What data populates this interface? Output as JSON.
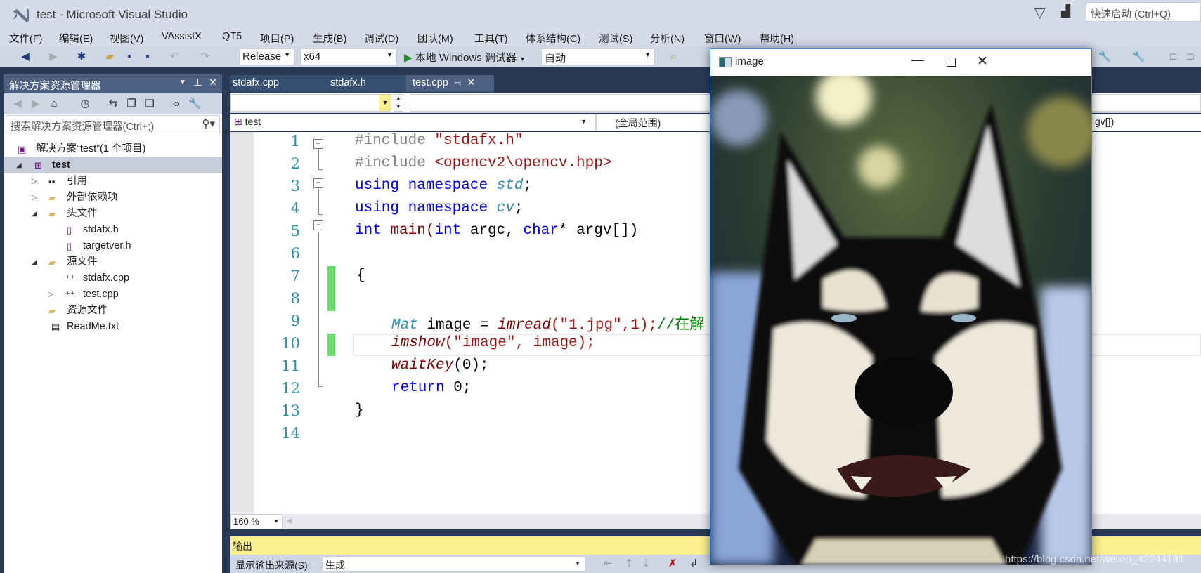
{
  "window": {
    "title": "test - Microsoft Visual Studio",
    "quick_launch_placeholder": "快速启动 (Ctrl+Q)"
  },
  "menu": [
    "文件(F)",
    "编辑(E)",
    "视图(V)",
    "VAssistX",
    "QT5",
    "项目(P)",
    "生成(B)",
    "调试(D)",
    "团队(M)",
    "工具(T)",
    "体系结构(C)",
    "测试(S)",
    "分析(N)",
    "窗口(W)",
    "帮助(H)"
  ],
  "toolbar": {
    "config": "Release",
    "platform": "x64",
    "run_label": "本地 Windows 调试器",
    "mode": "自动"
  },
  "solution_explorer": {
    "title": "解决方案资源管理器",
    "search_placeholder": "搜索解决方案资源管理器(Ctrl+;)",
    "items": [
      {
        "label": "解决方案“test”(1 个项目)"
      },
      {
        "label": "test"
      },
      {
        "label": "引用"
      },
      {
        "label": "外部依赖项"
      },
      {
        "label": "头文件"
      },
      {
        "label": "stdafx.h"
      },
      {
        "label": "targetver.h"
      },
      {
        "label": "源文件"
      },
      {
        "label": "stdafx.cpp"
      },
      {
        "label": "test.cpp"
      },
      {
        "label": "资源文件"
      },
      {
        "label": "ReadMe.txt"
      }
    ]
  },
  "tabs": [
    {
      "label": "stdafx.cpp"
    },
    {
      "label": "stdafx.h"
    },
    {
      "label": "test.cpp",
      "active": true
    }
  ],
  "nav": {
    "project": "test",
    "scope": "(全局范围)",
    "member": "gv[])"
  },
  "code_lines": [
    "1",
    "2",
    "3",
    "4",
    "5",
    "6",
    "7",
    "8",
    "9",
    "10",
    "11",
    "12",
    "13",
    "14"
  ],
  "code": {
    "l1a": "#include ",
    "l1b": "\"stdafx.h\"",
    "l2a": "#include ",
    "l2b": "<opencv2\\opencv.hpp>",
    "using": "using",
    "namespace": "namespace",
    "std": "std",
    "cv": "cv",
    "semi": ";",
    "int": "int",
    "main": " main(",
    "argc": " argc, ",
    "char": "char",
    "argv": "* argv[])",
    "open": "{",
    "mat": "Mat",
    "image_eq": " image = ",
    "imread": "imread",
    "imread_args": "(\"1.jpg\",1);",
    "comment": "//在解",
    "imshow": "imshow",
    "imshow_args": "(\"image\", image);",
    "waitkey": "waitKey",
    "waitkey_args": "(0);",
    "ret": "return",
    " zero": " 0;",
    "close": "}"
  },
  "zoom": "160 %",
  "output": {
    "title": "输出",
    "source_label": "显示输出来源(S):",
    "source_value": "生成"
  },
  "image_window": {
    "title": "image"
  },
  "watermark": "https://blog.csdn.net/weixin_42244181",
  "colors": {
    "title_bg": "#d6dbe9",
    "dark_bg": "#293955",
    "output_header": "#fdf08f",
    "change_bar": "#6ada6a"
  }
}
